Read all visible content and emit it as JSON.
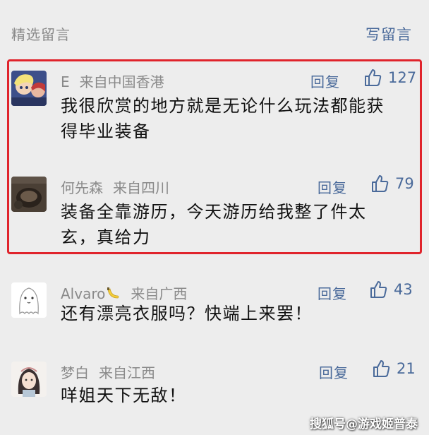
{
  "header": {
    "title": "精选留言",
    "write_label": "写留言"
  },
  "colors": {
    "link": "#4a6a9a",
    "highlight_border": "#e0242c",
    "background": "#ededed"
  },
  "comments": [
    {
      "user": "E",
      "location": "来自中国香港",
      "reply_label": "回复",
      "likes": "127",
      "text": "我很欣赏的地方就是无论什么玩法都能获得毕业装备",
      "avatar": "anime-avatar-icon"
    },
    {
      "user": "何先森",
      "location": "来自四川",
      "reply_label": "回复",
      "likes": "79",
      "text": "装备全靠游历，今天游历给我整了件太玄，真给力",
      "avatar": "photo-avatar-icon"
    },
    {
      "user": "Alvaro",
      "location": "来自广西",
      "reply_label": "回复",
      "likes": "43",
      "text": "还有漂亮衣服吗？快端上来罢！",
      "avatar": "ghost-doodle-avatar-icon",
      "name_emoji": "banana-icon"
    },
    {
      "user": "梦白",
      "location": "来自江西",
      "reply_label": "回复",
      "likes": "21",
      "text": "咩姐天下无敌！",
      "avatar": "girl-illustration-avatar-icon"
    }
  ],
  "watermark": "搜狐号@游戏姬普泰"
}
